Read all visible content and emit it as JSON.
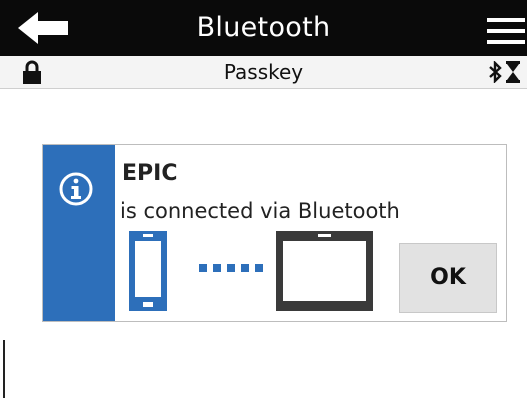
{
  "header": {
    "title": "Bluetooth",
    "back_icon": "arrow-left-icon",
    "menu_icon": "hamburger-menu-icon"
  },
  "status_bar": {
    "title": "Passkey",
    "lock_icon": "lock-icon",
    "bluetooth_icon": "bluetooth-icon",
    "hourglass_icon": "hourglass-icon"
  },
  "dialog": {
    "title": "EPIC",
    "message": "is connected via Bluetooth",
    "ok_label": "OK",
    "info_icon": "info-icon",
    "accent_color": "#2d6fba"
  }
}
